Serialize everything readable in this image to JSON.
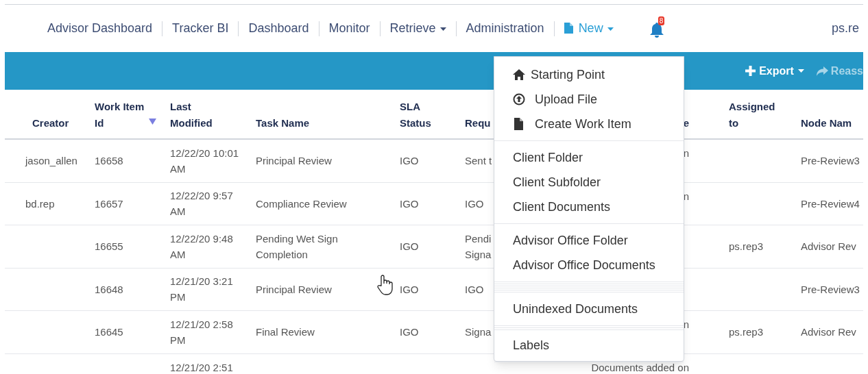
{
  "nav": {
    "items": [
      {
        "label": "Advisor Dashboard",
        "kind": "link",
        "expanded": false
      },
      {
        "label": "Tracker BI",
        "kind": "link",
        "expanded": false
      },
      {
        "label": "Dashboard",
        "kind": "link",
        "expanded": false
      },
      {
        "label": "Monitor",
        "kind": "link",
        "expanded": false
      },
      {
        "label": "Retrieve",
        "kind": "dropdown",
        "expanded": false
      },
      {
        "label": "Administration",
        "kind": "link",
        "expanded": false
      },
      {
        "label": "New",
        "kind": "file-dropdown",
        "expanded": true
      }
    ],
    "notifications": {
      "badge": "8"
    },
    "user": "ps.re"
  },
  "toolbar": {
    "buttons": [
      {
        "label": "Export",
        "kind": "plus-dropdown",
        "disabled": false
      },
      {
        "label": "Reass",
        "kind": "share",
        "disabled": true
      }
    ]
  },
  "table": {
    "columns": [
      {
        "label": "Creator",
        "sorted": false
      },
      {
        "label": "Work Item Id",
        "sorted": true
      },
      {
        "label": "Last Modified",
        "sorted": false
      },
      {
        "label": "Task Name",
        "sorted": false
      },
      {
        "label": "SLA Status",
        "sorted": false
      },
      {
        "label": "Requ",
        "sorted": false
      },
      {
        "label": "e",
        "sorted": false
      },
      {
        "label": "Assigned to",
        "sorted": false
      },
      {
        "label": "Node Nam",
        "sorted": false
      }
    ],
    "rows": [
      {
        "cells": [
          "jason_allen",
          "16658",
          "12/22/20 10:01 AM",
          "Principal Review",
          "IGO",
          "Sent t",
          "n",
          "",
          "Pre-Review3"
        ]
      },
      {
        "cells": [
          "bd.rep",
          "16657",
          "12/22/20 9:57 AM",
          "Compliance Review",
          "IGO",
          "IGO",
          "n",
          "",
          "Pre-Review4"
        ]
      },
      {
        "cells": [
          "",
          "16655",
          "12/22/20 9:48 AM",
          "Pending Wet Sign Completion",
          "IGO",
          "Pendi\nSigna",
          "",
          "ps.rep3",
          "Advisor Rev"
        ]
      },
      {
        "cells": [
          "",
          "16648",
          "12/21/20 3:21 PM",
          "Principal Review",
          "IGO",
          "IGO",
          "",
          "",
          "Pre-Review3"
        ]
      },
      {
        "cells": [
          "",
          "16645",
          "12/21/20 2:58 PM",
          "Final Review",
          "IGO",
          "Signa",
          "n",
          "ps.rep3",
          "Advisor Rev"
        ]
      },
      {
        "cells": [
          "",
          "",
          "12/21/20 2:51",
          "",
          "",
          "",
          "Documents added on",
          "",
          ""
        ]
      }
    ]
  },
  "menu": {
    "groups": [
      [
        {
          "label": "Starting Point",
          "kind": "home"
        },
        {
          "label": "Upload File",
          "kind": "upload"
        },
        {
          "label": "Create Work Item",
          "kind": "file"
        }
      ],
      [
        {
          "label": "Client Folder",
          "kind": "plain"
        },
        {
          "label": "Client Subfolder",
          "kind": "plain"
        },
        {
          "label": "Client Documents",
          "kind": "plain"
        }
      ],
      [
        {
          "label": "Advisor Office Folder",
          "kind": "plain"
        },
        {
          "label": "Advisor Office Documents",
          "kind": "plain"
        }
      ],
      [
        {
          "label": "Unindexed Documents",
          "kind": "plain"
        }
      ],
      [
        {
          "label": "Labels",
          "kind": "plain"
        }
      ]
    ]
  }
}
